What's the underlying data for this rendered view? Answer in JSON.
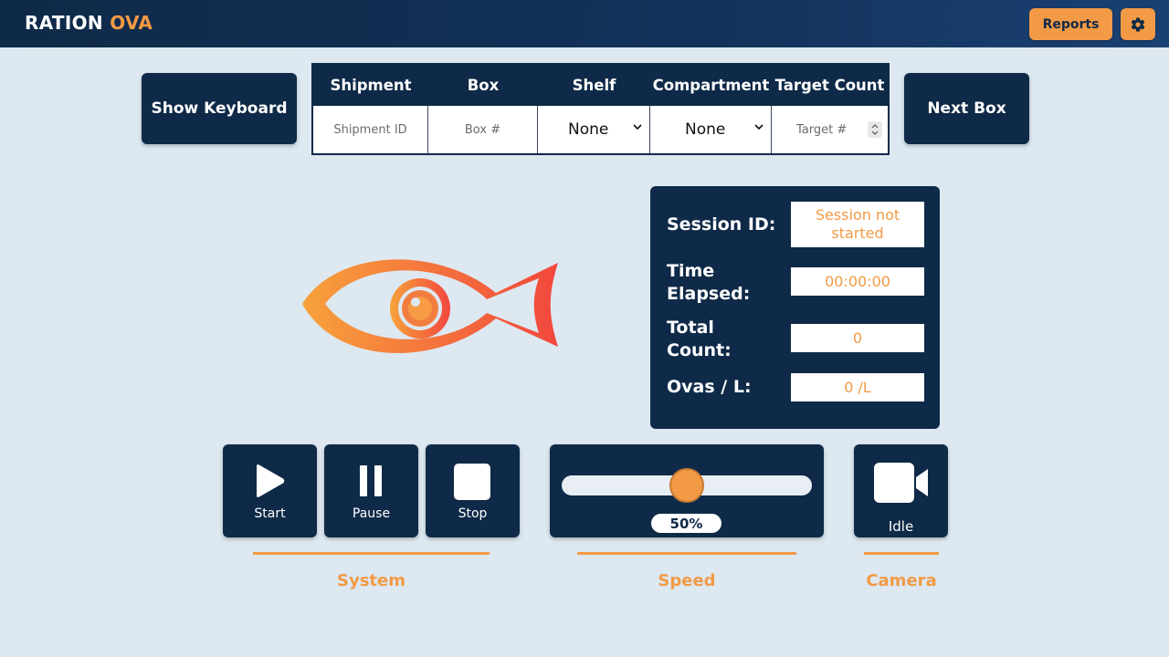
{
  "header": {
    "brand_primary": "RATION",
    "brand_accent": "OVA",
    "reports_label": "Reports",
    "settings_icon": "gear-icon"
  },
  "toolbar": {
    "show_keyboard_label": "Show Keyboard",
    "next_box_label": "Next Box"
  },
  "shipment_table": {
    "headers": [
      "Shipment",
      "Box",
      "Shelf",
      "Compartment",
      "Target Count"
    ],
    "shipment_placeholder": "Shipment ID",
    "box_placeholder": "Box #",
    "shelf_value": "None",
    "compartment_value": "None",
    "target_placeholder": "Target #"
  },
  "session": {
    "session_id_label": "Session ID:",
    "session_id_value": "Session not started",
    "time_label": "Time Elapsed:",
    "time_value": "00:00:00",
    "total_label": "Total Count:",
    "total_value": "0",
    "ovas_label": "Ovas / L:",
    "ovas_value": "0 /L"
  },
  "system": {
    "title": "System",
    "start_label": "Start",
    "pause_label": "Pause",
    "stop_label": "Stop"
  },
  "speed": {
    "title": "Speed",
    "value_label": "50%",
    "level": 0.5
  },
  "camera": {
    "title": "Camera",
    "status_label": "Idle",
    "icon": "video-camera-icon"
  },
  "colors": {
    "navy": "#0f2a48",
    "accent": "#f29a45",
    "background": "#dde8f1",
    "logo_gradient_start": "#f7a23b",
    "logo_gradient_end": "#f2473e"
  }
}
